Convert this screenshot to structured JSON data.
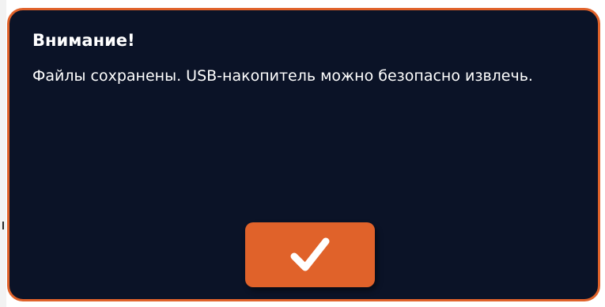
{
  "dialog": {
    "title": "Внимание!",
    "message": "Файлы сохранены. USB-накопитель можно безопасно извлечь.",
    "confirm_button": {
      "icon": "checkmark-icon"
    }
  },
  "colors": {
    "background": "#0b1327",
    "accent": "#e0622a",
    "text": "#ffffff"
  }
}
